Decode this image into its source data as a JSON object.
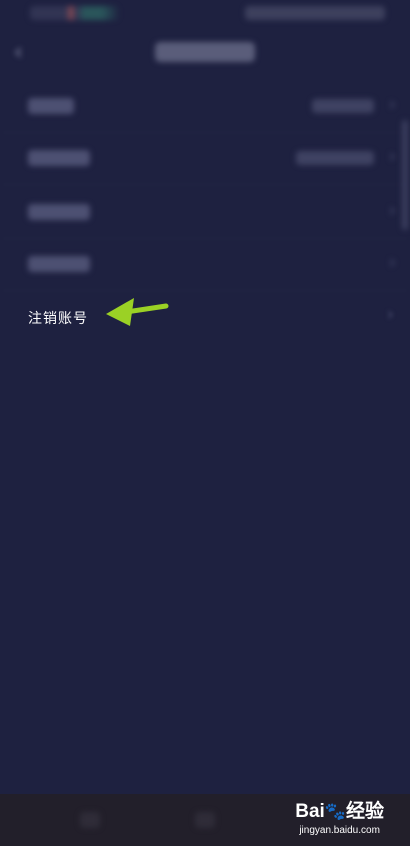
{
  "delete_account": {
    "label": "注销账号"
  },
  "watermark": {
    "logo_left": "Bai",
    "logo_right": "经验",
    "url": "jingyan.baidu.com"
  },
  "colors": {
    "background": "#1e2140",
    "arrow": "#9bd125",
    "nav_bar": "#221f2a"
  },
  "icons": {
    "back": "chevron-left-icon",
    "row_chevron": "chevron-right-icon",
    "pointer": "arrow-pointer-icon",
    "paw": "paw-icon"
  }
}
